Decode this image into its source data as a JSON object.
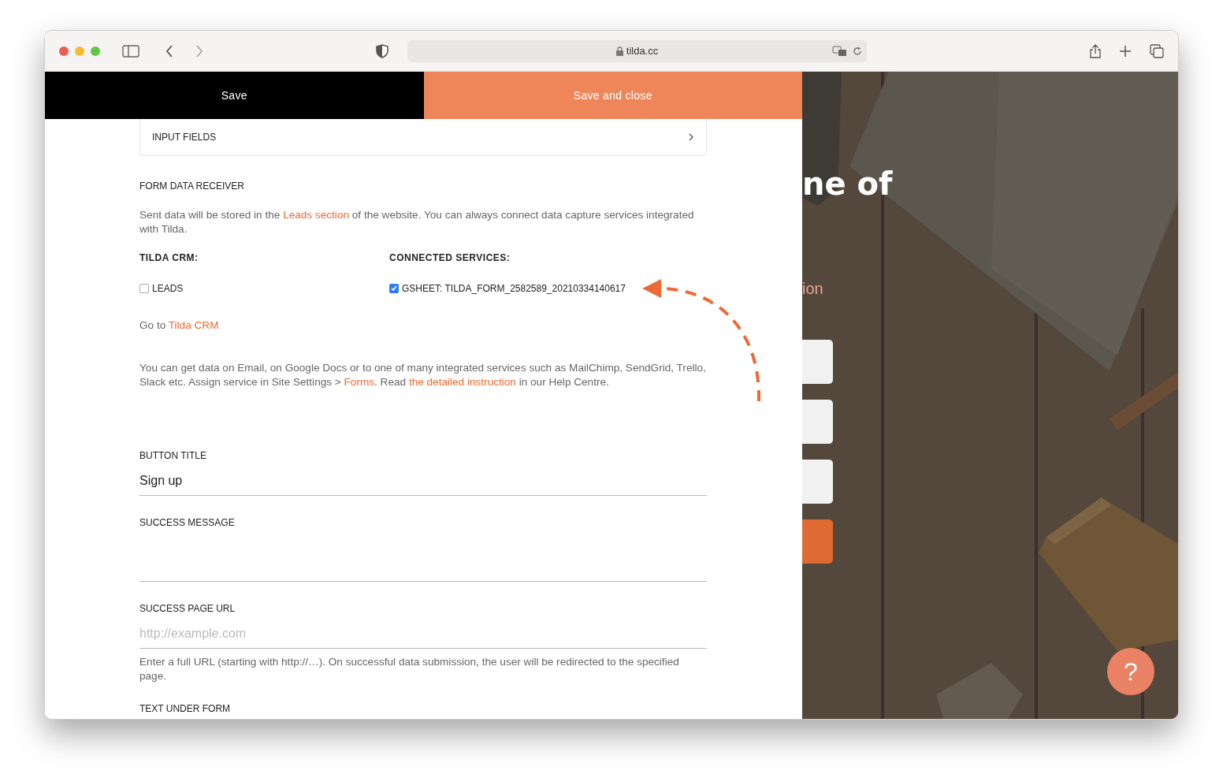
{
  "browser": {
    "url": "tilda.cc"
  },
  "header_buttons": [
    {
      "label": "Save",
      "kind": "dark"
    },
    {
      "label": "Save and close",
      "kind": "accent"
    }
  ],
  "input_fields_row": {
    "label": "INPUT FIELDS"
  },
  "receiver": {
    "title": "FORM DATA RECEIVER",
    "description": [
      {
        "kind": "text",
        "text": "Sent data will be stored in the "
      },
      {
        "kind": "link",
        "text": "Leads section"
      },
      {
        "kind": "text",
        "text": " of the website. You can always connect data capture services integrated with Tilda."
      }
    ],
    "crm_heading": "TILDA CRM:",
    "services_heading": "CONNECTED SERVICES:",
    "crm_options": [
      {
        "label": "LEADS",
        "checked": false
      }
    ],
    "service_options": [
      {
        "label": "GSHEET: TILDA_FORM_2582589_20210334140617",
        "checked": true
      }
    ],
    "crm_line": [
      {
        "kind": "text",
        "text": "Go to "
      },
      {
        "kind": "link",
        "text": "Tilda CRM"
      }
    ],
    "help_text": [
      {
        "kind": "text",
        "text": "You can get data on Email, on Google Docs or to one of many integrated services such as MailChimp, SendGrid, Trello, Slack etc. Assign service in Site Settings > "
      },
      {
        "kind": "link",
        "text": "Forms"
      },
      {
        "kind": "text",
        "text": ". Read "
      },
      {
        "kind": "link",
        "text": "the detailed instruction"
      },
      {
        "kind": "text",
        "text": " in our Help Centre."
      }
    ]
  },
  "fields": [
    {
      "label": "BUTTON TITLE",
      "value": "Sign up"
    },
    {
      "label": "SUCCESS MESSAGE"
    },
    {
      "label": "SUCCESS PAGE URL",
      "placeholder": "http://example.com",
      "hint": "Enter a full URL (starting with http://…). On successful data submission, the user will be redirected to the specified page."
    },
    {
      "label": "TEXT UNDER FORM"
    }
  ],
  "preview": {
    "heading": "ne of",
    "subtext": "ion",
    "form_inputs": [
      {
        "kind": "input"
      },
      {
        "kind": "input"
      },
      {
        "kind": "input"
      },
      {
        "kind": "submit"
      }
    ]
  },
  "help_button": {
    "label": "?"
  }
}
